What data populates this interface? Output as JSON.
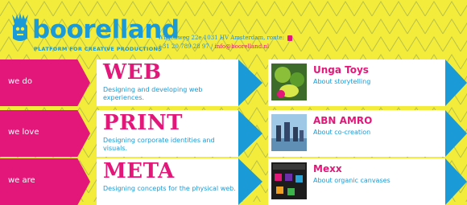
{
  "header": {
    "logo_text": "boorelland",
    "tagline": "PLATFORM FOR CREATIVE PRODUCTIONS",
    "address_line": "Wilgenweg 22e 1031 HV Amsterdam, route:",
    "phone_line": "+31 20 789 28 97 /",
    "email": "info@boorelland.nl",
    "route_icon": "map-pin-icon"
  },
  "colors": {
    "background": "#f4ec3a",
    "accent_pink": "#e3177a",
    "accent_blue": "#1a9ad6",
    "card": "#ffffff"
  },
  "rows": [
    {
      "tab": "we do",
      "title": "WEB",
      "desc": "Designing and developing web experiences.",
      "client_title": "Unga Toys",
      "client_desc": "About storytelling"
    },
    {
      "tab": "we love",
      "title": "PRINT",
      "desc": "Designing corporate identities and visuals.",
      "client_title": "ABN AMRO",
      "client_desc": "About co-creation"
    },
    {
      "tab": "we are",
      "title": "META",
      "desc": "Designing concepts for the physical web.",
      "client_title": "Mexx",
      "client_desc": "About organic canvases"
    }
  ]
}
